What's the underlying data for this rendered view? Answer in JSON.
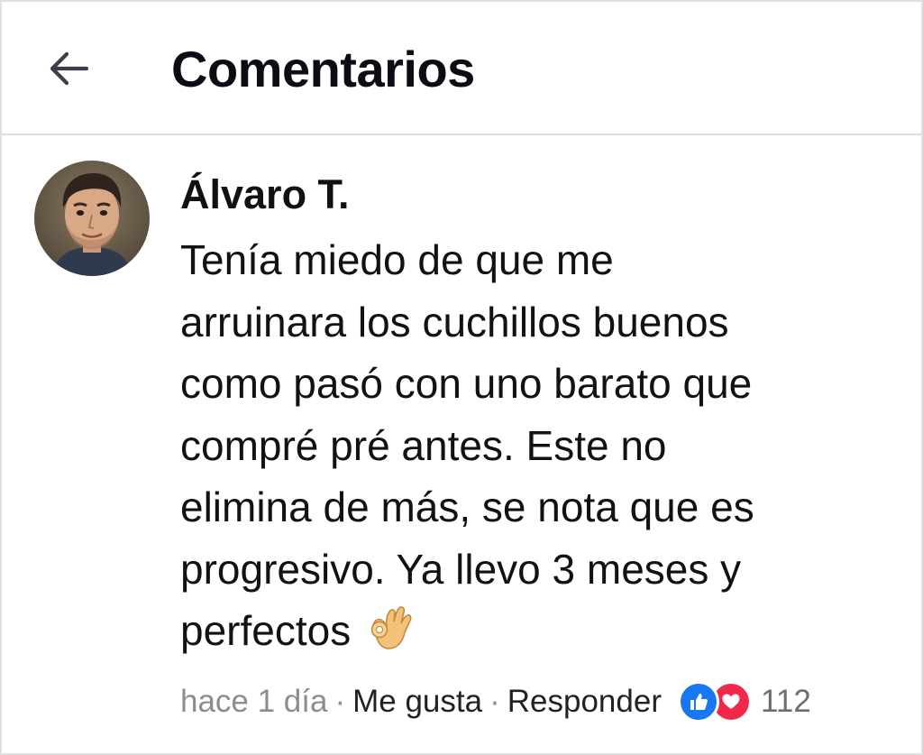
{
  "header": {
    "back_icon": "arrow-left-icon",
    "title": "Comentarios"
  },
  "comment": {
    "author": "Álvaro T.",
    "avatar_icon": "user-avatar",
    "text": "Tenía miedo de que me\narruinara los cuchillos buenos\ncomo pasó con uno barato que\ncompré pré antes. Este no\nelimina de más, se  nota que es\nprogresivo. Ya llevo 3 meses y\nperfectos",
    "emoji_icon": "ok-hand-icon",
    "time": "hace 1 día",
    "separator": "·",
    "like_label": "Me gusta",
    "reply_label": "Responder",
    "reactions": {
      "icons": [
        "like-icon",
        "heart-icon"
      ],
      "count": "112",
      "colors": {
        "like": "#1877f2",
        "love": "#f02849"
      }
    }
  }
}
